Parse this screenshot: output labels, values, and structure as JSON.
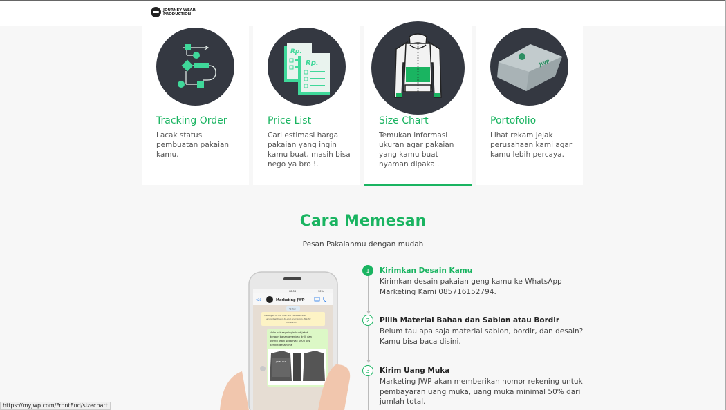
{
  "header": {
    "logo_line1": "JOURNEY WEAR",
    "logo_line2": "PRODUCTION"
  },
  "features": [
    {
      "title": "Tracking Order",
      "desc": "Lacak status pembuatan pakaian kamu.",
      "icon": "flowchart-icon"
    },
    {
      "title": "Price List",
      "desc": "Cari estimasi harga pakaian yang ingin kamu buat, masih bisa nego ya bro !.",
      "icon": "price-document-icon",
      "rp": "Rp."
    },
    {
      "title": "Size Chart",
      "desc": "Temukan informasi ukuran agar pakaian yang kamu buat nyaman dipakai.",
      "icon": "jacket-icon",
      "active": true
    },
    {
      "title": "Portofolio",
      "desc": "Lihat rekam jejak perusahaan kami agar kamu lebih percaya.",
      "icon": "folded-shirt-icon"
    }
  ],
  "how_to_order": {
    "title": "Cara Memesan",
    "subtitle": "Pesan Pakaianmu dengan mudah",
    "steps": [
      {
        "number": "1",
        "title": "Kirimkan Desain Kamu",
        "desc": "Kirimkan desain pakaian geng kamu ke WhatsApp Marketing Kami 085716152794."
      },
      {
        "number": "2",
        "title": "Pilih Material Bahan dan Sablon atau Bordir",
        "desc": "Belum tau apa saja material sablon, bordir, dan desain? Kamu bisa baca disini."
      },
      {
        "number": "3",
        "title": "Kirim Uang Muka",
        "desc": "Marketing JWP akan memberikan nomor rekening untuk pembayaran uang muka, uang muka minimal 50% dari jumlah total."
      }
    ]
  },
  "phone": {
    "time": "08:58",
    "battery": "90%",
    "back_count": "28",
    "contact": "Marketing JWP",
    "date_label": "Today",
    "encryption_notice": "Messages to this chat and calls are now secured with end-to-end encryption. Tap for more info.",
    "message_line1": "Hallo kak saya ingin buat jaket",
    "message_line2": "dengan bahan american drill, dan",
    "message_line3": "puring asahi sebanyak 1000 pcs.",
    "message_line4": "Berikut desainnya",
    "jacket_text": "JW BLACK"
  },
  "status_bar": {
    "url": "https://myjwp.com/FrontEnd/sizechart"
  },
  "colors": {
    "accent": "#1ab461",
    "circle_bg": "#343841",
    "page_bg": "#f7f7f7"
  }
}
